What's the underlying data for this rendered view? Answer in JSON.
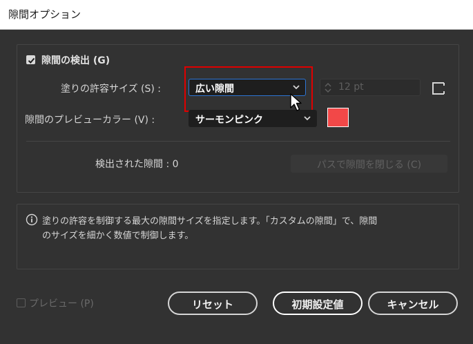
{
  "window": {
    "title": "隙間オプション"
  },
  "gap_detection": {
    "checkbox_label": "隙間の検出 (G)",
    "checked": true,
    "paint_tolerance": {
      "label": "塗りの許容サイズ (S) :",
      "selected": "広い隙間",
      "custom_value": "12 pt"
    },
    "preview_color": {
      "label": "隙間のプレビューカラー (V) :",
      "selected": "サーモンピンク",
      "swatch_color": "#f24848"
    },
    "detected": {
      "label": "検出された隙間 : 0"
    },
    "close_gaps_button": "パスで隙間を閉じる (C)"
  },
  "info": {
    "line1": "塗りの許容を制御する最大の隙間サイズを指定します。「カスタムの隙間」で、隙間",
    "line2": "のサイズを細かく数値で制御します。"
  },
  "footer": {
    "preview_label": "プレビュー (P)",
    "reset_label": "リセット",
    "defaults_label": "初期設定値",
    "cancel_label": "キャンセル"
  },
  "colors": {
    "accent_focus": "#2d76d6",
    "highlight_annotation": "#e00000",
    "dialog_background": "#323232"
  },
  "icons": {
    "info": "info-circle-icon",
    "chevron": "chevron-down-icon",
    "stepper": "stepper-arrows-icon",
    "custom_gap": "corner-bracket-icon",
    "cursor": "mouse-cursor-icon"
  }
}
